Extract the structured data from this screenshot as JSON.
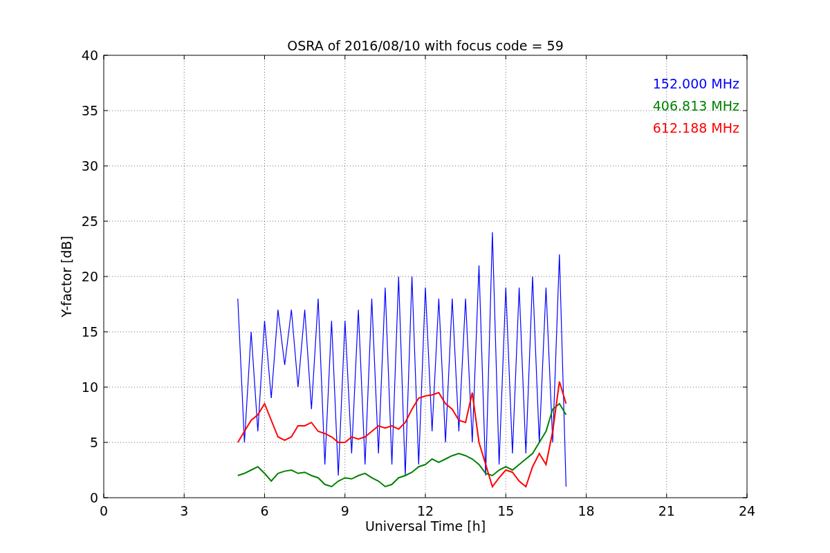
{
  "chart_data": {
    "type": "line",
    "title": "OSRA of 2016/08/10 with focus code = 59",
    "xlabel": "Universal Time [h]",
    "ylabel": "Y-factor [dB]",
    "grid": true,
    "xlim": [
      0,
      24
    ],
    "ylim": [
      0,
      40
    ],
    "xticks": [
      0,
      3,
      6,
      9,
      12,
      15,
      18,
      21,
      24
    ],
    "yticks": [
      0,
      5,
      10,
      15,
      20,
      25,
      30,
      35,
      40
    ],
    "x": [
      5,
      5.25,
      5.5,
      5.75,
      6,
      6.25,
      6.5,
      6.75,
      7,
      7.25,
      7.5,
      7.75,
      8,
      8.25,
      8.5,
      8.75,
      9,
      9.25,
      9.5,
      9.75,
      10,
      10.25,
      10.5,
      10.75,
      11,
      11.25,
      11.5,
      11.75,
      12,
      12.25,
      12.5,
      12.75,
      13,
      13.25,
      13.5,
      13.75,
      14,
      14.25,
      14.5,
      14.75,
      15,
      15.25,
      15.5,
      15.75,
      16,
      16.25,
      16.5,
      16.75,
      17,
      17.25
    ],
    "series": [
      {
        "name": "152.000 MHz",
        "color": "#0000ff",
        "values": [
          18,
          5,
          15,
          6,
          16,
          9,
          17,
          12,
          17,
          10,
          17,
          8,
          18,
          3,
          16,
          2,
          16,
          4,
          17,
          3,
          18,
          4,
          19,
          3,
          20,
          2,
          20,
          3,
          19,
          6,
          18,
          5,
          18,
          6,
          18,
          5,
          21,
          2,
          24,
          3,
          19,
          4,
          19,
          4,
          20,
          5,
          19,
          5,
          22,
          1
        ]
      },
      {
        "name": "406.813 MHz",
        "color": "#008000",
        "values": [
          2,
          2.2,
          2.5,
          2.8,
          2.2,
          1.5,
          2.2,
          2.4,
          2.5,
          2.2,
          2.3,
          2.0,
          1.8,
          1.2,
          1.0,
          1.5,
          1.8,
          1.7,
          2.0,
          2.2,
          1.8,
          1.5,
          1.0,
          1.2,
          1.8,
          2.0,
          2.3,
          2.8,
          3.0,
          3.5,
          3.2,
          3.5,
          3.8,
          4.0,
          3.8,
          3.5,
          3.0,
          2.2,
          2.0,
          2.5,
          2.8,
          2.5,
          3.0,
          3.5,
          4.0,
          5.0,
          6.0,
          8.0,
          8.5,
          7.5
        ]
      },
      {
        "name": "612.188 MHz",
        "color": "#ff0000",
        "values": [
          5,
          6,
          7,
          7.5,
          8.5,
          7,
          5.5,
          5.2,
          5.5,
          6.5,
          6.5,
          6.8,
          6,
          5.8,
          5.5,
          5,
          5,
          5.5,
          5.3,
          5.5,
          6,
          6.5,
          6.3,
          6.5,
          6.2,
          6.8,
          8,
          9,
          9.2,
          9.3,
          9.5,
          8.5,
          8,
          7,
          6.8,
          9.5,
          5,
          3,
          1,
          1.8,
          2.5,
          2.3,
          1.5,
          1,
          2.8,
          4,
          3,
          6,
          10.5,
          8.5
        ]
      }
    ]
  }
}
